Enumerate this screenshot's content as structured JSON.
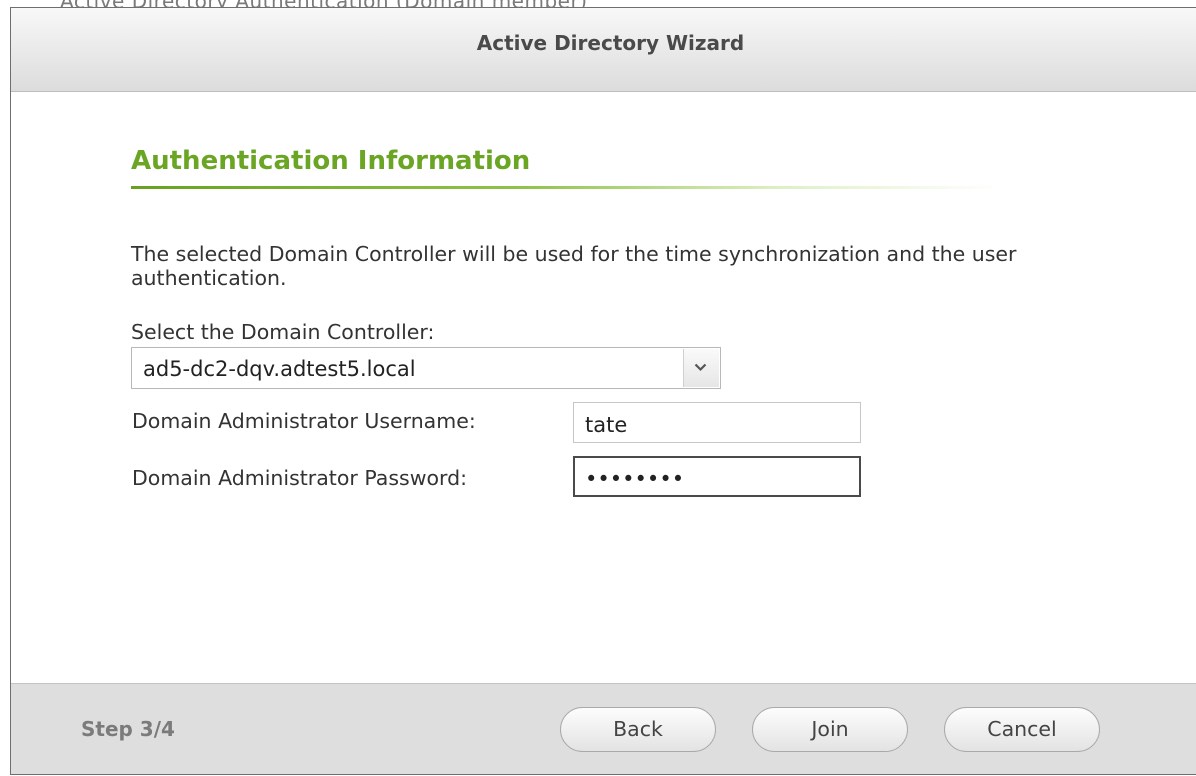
{
  "background": {
    "partial_text": "Active Directory Authentication (Domain member)"
  },
  "dialog": {
    "title": "Active Directory Wizard",
    "section_title": "Authentication Information",
    "description": "The selected Domain Controller will be used for the time synchronization and the user authentication.",
    "select_label": "Select the Domain Controller:",
    "domain_controller": {
      "selected": "ad5-dc2-dqv.adtest5.local"
    },
    "username_label": "Domain Administrator Username:",
    "username_value": "tate",
    "password_label": "Domain Administrator Password:",
    "password_value": "••••••••"
  },
  "footer": {
    "step": "Step 3/4",
    "back_label": "Back",
    "join_label": "Join",
    "cancel_label": "Cancel"
  },
  "colors": {
    "accent_green": "#6aa524",
    "title_text": "#4a4a4a",
    "footer_bg": "#dedede"
  },
  "icons": {
    "dropdown": "chevron-down-icon"
  }
}
